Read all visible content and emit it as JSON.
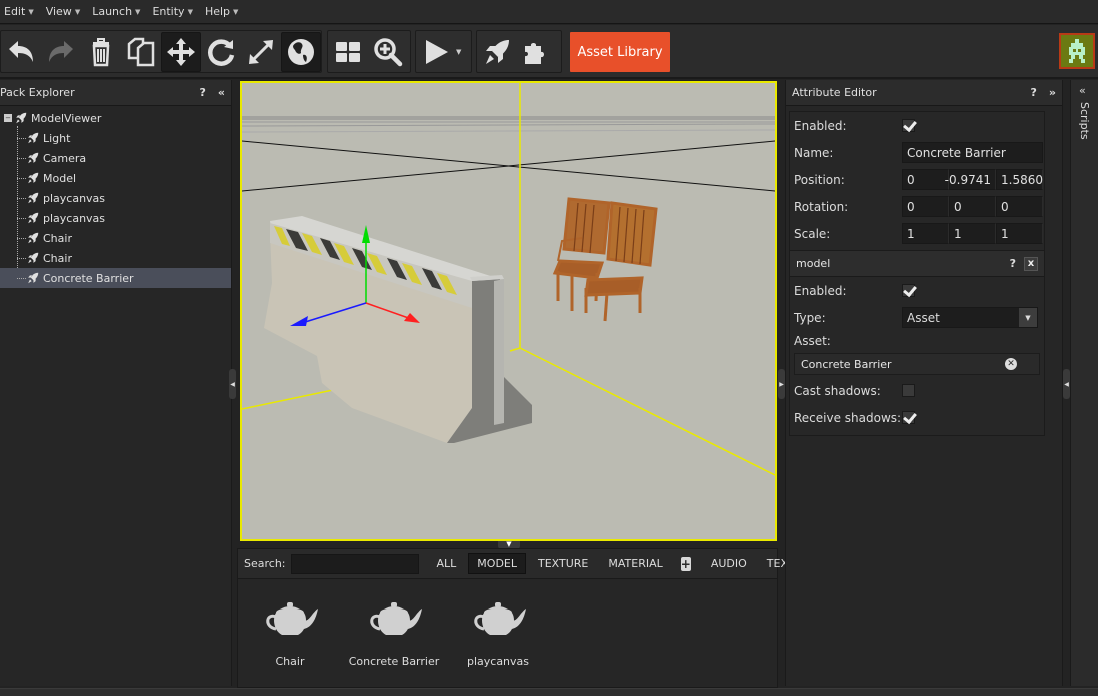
{
  "menu": [
    {
      "label": "Edit"
    },
    {
      "label": "View"
    },
    {
      "label": "Launch"
    },
    {
      "label": "Entity"
    },
    {
      "label": "Help"
    }
  ],
  "toolbar": {
    "asset_library_label": "Asset Library",
    "accent_color": "#e8502a",
    "tools": [
      {
        "icon": "undo-icon"
      },
      {
        "icon": "redo-icon",
        "disabled": true
      },
      {
        "icon": "delete-icon"
      },
      {
        "icon": "duplicate-icon"
      },
      {
        "icon": "translate-icon",
        "active": true
      },
      {
        "icon": "rotate-icon"
      },
      {
        "icon": "scale-icon"
      },
      {
        "icon": "world-space-icon",
        "active": true
      },
      {
        "icon": "grid-icon"
      },
      {
        "icon": "zoom-fit-icon"
      },
      {
        "icon": "play-icon"
      },
      {
        "icon": "publish-rocket-icon"
      },
      {
        "icon": "plugin-icon"
      }
    ]
  },
  "pack_explorer": {
    "title": "Pack Explorer",
    "help": "?",
    "collapse": "«",
    "root": "ModelViewer",
    "children": [
      "Light",
      "Camera",
      "Model",
      "playcanvas",
      "playcanvas",
      "Chair",
      "Chair",
      "Concrete Barrier"
    ],
    "selected": "Concrete Barrier"
  },
  "asset_panel": {
    "search_label": "Search:",
    "search_value": "",
    "filters": [
      "ALL",
      "MODEL",
      "TEXTURE",
      "MATERIAL",
      "AUDIO",
      "TEXT"
    ],
    "active_filter": "MODEL",
    "add_label": "+",
    "assets": [
      {
        "name": "Chair",
        "icon": "teapot-model-icon"
      },
      {
        "name": "Concrete Barrier",
        "icon": "teapot-model-icon"
      },
      {
        "name": "playcanvas",
        "icon": "teapot-model-icon"
      }
    ]
  },
  "attribute_editor": {
    "title": "Attribute Editor",
    "help": "?",
    "collapse": "»",
    "enabled_label": "Enabled:",
    "enabled": true,
    "name_label": "Name:",
    "name_value": "Concrete Barrier",
    "position_label": "Position:",
    "position": [
      "0",
      "-0.9741",
      "1.5860"
    ],
    "rotation_label": "Rotation:",
    "rotation": [
      "0",
      "0",
      "0"
    ],
    "scale_label": "Scale:",
    "scale": [
      "1",
      "1",
      "1"
    ],
    "component": {
      "title": "model",
      "help": "?",
      "close": "x",
      "enabled_label": "Enabled:",
      "enabled": true,
      "type_label": "Type:",
      "type_value": "Asset",
      "asset_label": "Asset:",
      "asset_value": "Concrete Barrier",
      "cast_shadows_label": "Cast shadows:",
      "cast_shadows": false,
      "receive_shadows_label": "Receive shadows:",
      "receive_shadows": true
    }
  },
  "scripts_panel": {
    "label": "Scripts",
    "collapse": "«"
  },
  "viewport": {
    "selection_color": "#e9e900",
    "background_color": "#bbbbb2"
  }
}
